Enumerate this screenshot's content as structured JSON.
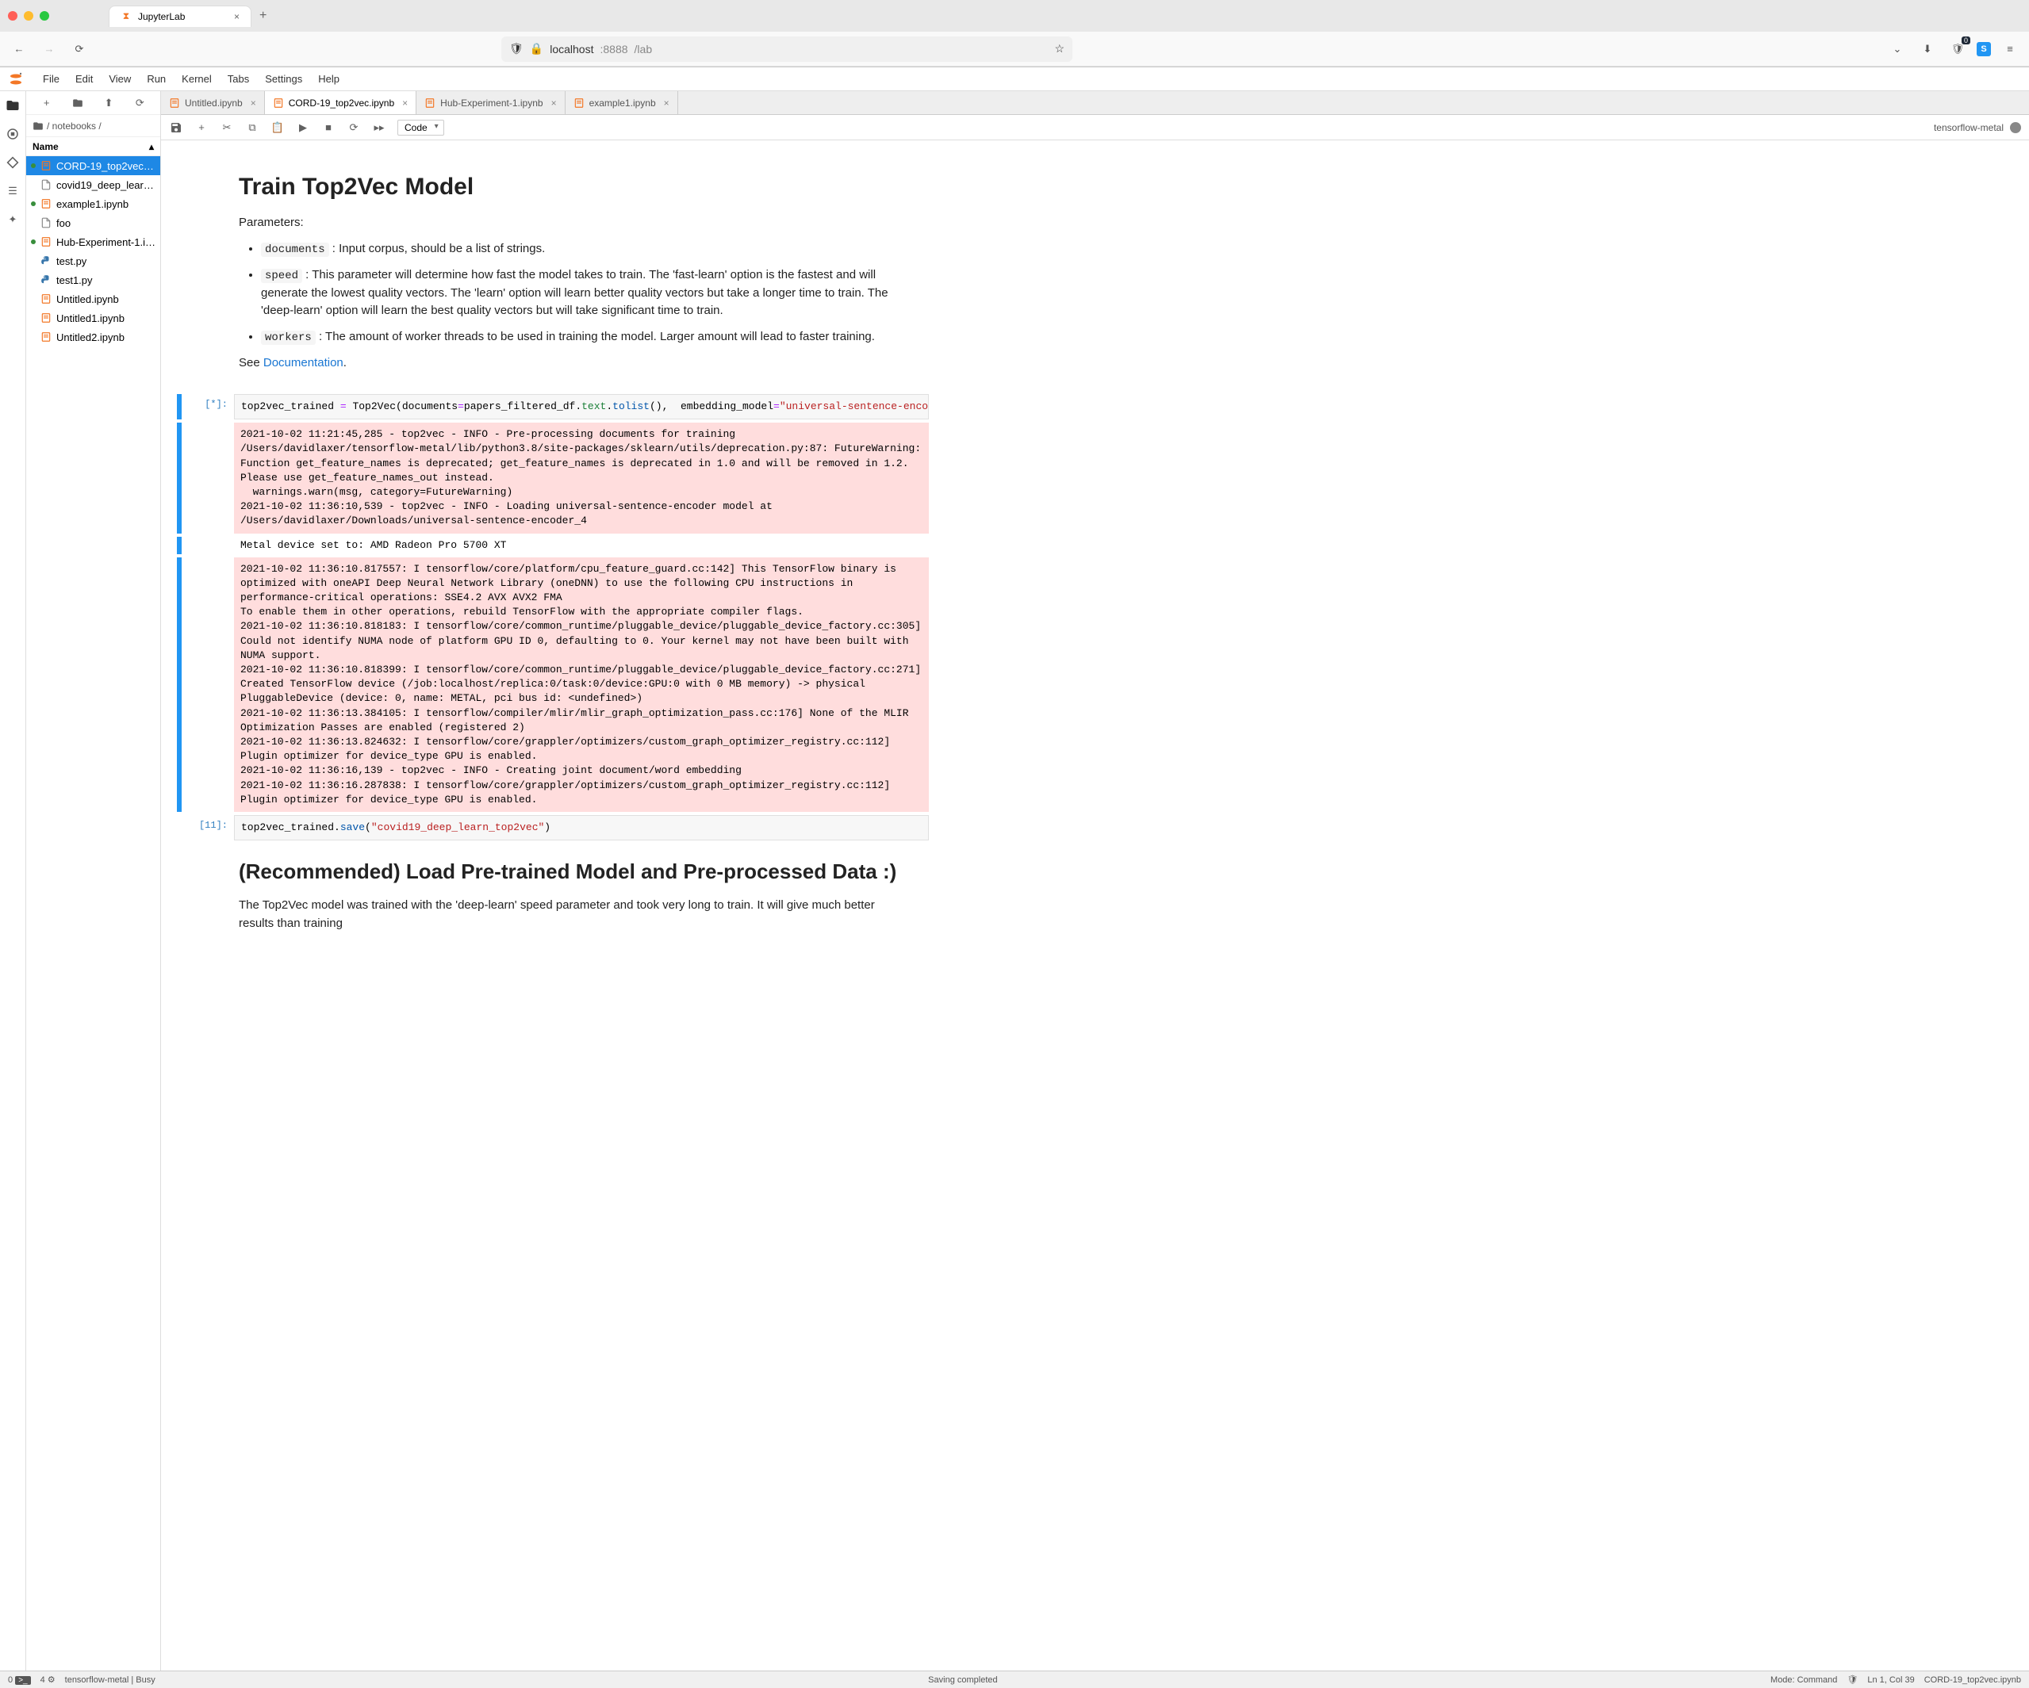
{
  "browser": {
    "tab_title": "JupyterLab",
    "url_host": "localhost",
    "url_port": ":8888",
    "url_path": "/lab",
    "ext_badge": "0"
  },
  "menu": {
    "items": [
      "File",
      "Edit",
      "View",
      "Run",
      "Kernel",
      "Tabs",
      "Settings",
      "Help"
    ]
  },
  "sidebar": {
    "breadcrumb": "/ notebooks /",
    "col_name": "Name",
    "files": [
      {
        "name": "CORD-19_top2vec.i…",
        "kind": "nb",
        "running": true,
        "selected": true
      },
      {
        "name": "covid19_deep_learn…",
        "kind": "file",
        "running": false,
        "selected": false
      },
      {
        "name": "example1.ipynb",
        "kind": "nb",
        "running": true,
        "selected": false
      },
      {
        "name": "foo",
        "kind": "file",
        "running": false,
        "selected": false
      },
      {
        "name": "Hub-Experiment-1.i…",
        "kind": "nb",
        "running": true,
        "selected": false
      },
      {
        "name": "test.py",
        "kind": "py",
        "running": false,
        "selected": false
      },
      {
        "name": "test1.py",
        "kind": "py",
        "running": false,
        "selected": false
      },
      {
        "name": "Untitled.ipynb",
        "kind": "nb",
        "running": false,
        "selected": false
      },
      {
        "name": "Untitled1.ipynb",
        "kind": "nb",
        "running": false,
        "selected": false
      },
      {
        "name": "Untitled2.ipynb",
        "kind": "nb",
        "running": false,
        "selected": false
      }
    ]
  },
  "doctabs": [
    {
      "label": "Untitled.ipynb",
      "active": false
    },
    {
      "label": "CORD-19_top2vec.ipynb",
      "active": true
    },
    {
      "label": "Hub-Experiment-1.ipynb",
      "active": false
    },
    {
      "label": "example1.ipynb",
      "active": false
    }
  ],
  "toolbar": {
    "celltype": "Code",
    "kernel": "tensorflow-metal"
  },
  "notebook": {
    "md1_title": "Train Top2Vec Model",
    "md1_params_label": "Parameters:",
    "md1_li1_code": "documents",
    "md1_li1_rest": " : Input corpus, should be a list of strings.",
    "md1_li2_code": "speed",
    "md1_li2_rest": " : This parameter will determine how fast the model takes to train. The 'fast-learn' option is the fastest and will generate the lowest quality vectors. The 'learn' option will learn better quality vectors but take a longer time to train. The 'deep-learn' option will learn the best quality vectors but will take significant time to train.",
    "md1_li3_code": "workers",
    "md1_li3_rest": " : The amount of worker threads to be used in training the model. Larger amount will lead to faster training.",
    "md1_see": "See ",
    "md1_doc": "Documentation",
    "md1_dot": ".",
    "cell1_prompt": "[*]:",
    "cell1_code_html": "top2vec_trained <span class='tok-op'>=</span> Top2Vec(documents<span class='tok-op'>=</span>papers_filtered_df.<span class='tok-attr'>text</span>.<span class='tok-fn'>tolist</span>(),  embedding_model<span class='tok-op'>=</span><span class='tok-str'>\"universal-sentence-encoder\"</span>,   embe",
    "cell1_stderr1": "2021-10-02 11:21:45,285 - top2vec - INFO - Pre-processing documents for training\n/Users/davidlaxer/tensorflow-metal/lib/python3.8/site-packages/sklearn/utils/deprecation.py:87: FutureWarning: Function get_feature_names is deprecated; get_feature_names is deprecated in 1.0 and will be removed in 1.2. Please use get_feature_names_out instead.\n  warnings.warn(msg, category=FutureWarning)\n2021-10-02 11:36:10,539 - top2vec - INFO - Loading universal-sentence-encoder model at /Users/davidlaxer/Downloads/universal-sentence-encoder_4",
    "cell1_stdout": "Metal device set to: AMD Radeon Pro 5700 XT",
    "cell1_stderr2": "2021-10-02 11:36:10.817557: I tensorflow/core/platform/cpu_feature_guard.cc:142] This TensorFlow binary is optimized with oneAPI Deep Neural Network Library (oneDNN) to use the following CPU instructions in performance-critical operations: SSE4.2 AVX AVX2 FMA\nTo enable them in other operations, rebuild TensorFlow with the appropriate compiler flags.\n2021-10-02 11:36:10.818183: I tensorflow/core/common_runtime/pluggable_device/pluggable_device_factory.cc:305] Could not identify NUMA node of platform GPU ID 0, defaulting to 0. Your kernel may not have been built with NUMA support.\n2021-10-02 11:36:10.818399: I tensorflow/core/common_runtime/pluggable_device/pluggable_device_factory.cc:271] Created TensorFlow device (/job:localhost/replica:0/task:0/device:GPU:0 with 0 MB memory) -> physical PluggableDevice (device: 0, name: METAL, pci bus id: <undefined>)\n2021-10-02 11:36:13.384105: I tensorflow/compiler/mlir/mlir_graph_optimization_pass.cc:176] None of the MLIR Optimization Passes are enabled (registered 2)\n2021-10-02 11:36:13.824632: I tensorflow/core/grappler/optimizers/custom_graph_optimizer_registry.cc:112] Plugin optimizer for device_type GPU is enabled.\n2021-10-02 11:36:16,139 - top2vec - INFO - Creating joint document/word embedding\n2021-10-02 11:36:16.287838: I tensorflow/core/grappler/optimizers/custom_graph_optimizer_registry.cc:112] Plugin optimizer for device_type GPU is enabled.",
    "cell2_prompt": "[11]:",
    "cell2_code_html": "top2vec_trained.<span class='tok-fn'>save</span>(<span class='tok-str'>\"covid19_deep_learn_top2vec\"</span>)",
    "md2_title": "(Recommended) Load Pre-trained Model and Pre-processed Data :)",
    "md2_p": "The Top2Vec model was trained with the 'deep-learn' speed parameter and took very long to train. It will give much better results than training"
  },
  "statusbar": {
    "terminals": "0",
    "kernels_icon": "4",
    "kernel_status": "tensorflow-metal | Busy",
    "center": "Saving completed",
    "mode": "Mode: Command",
    "ln": "Ln 1, Col 39",
    "file": "CORD-19_top2vec.ipynb"
  }
}
